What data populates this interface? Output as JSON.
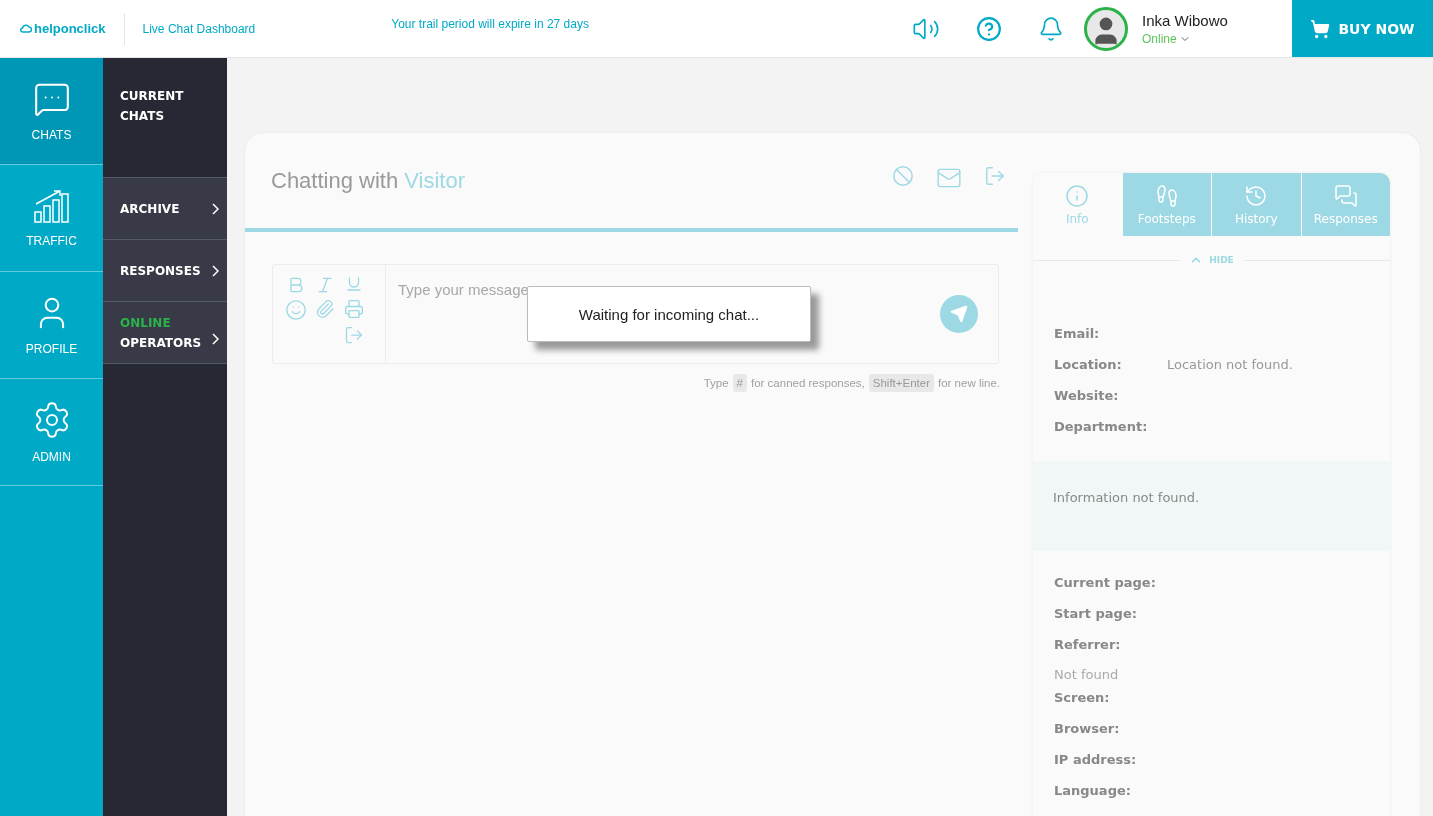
{
  "header": {
    "logo": "helponclick",
    "subtitle": "Live Chat Dashboard",
    "notice": "Your trail period will expire in 27 days",
    "user": {
      "name": "Inka Wibowo",
      "status": "Online"
    },
    "buy": "BUY NOW"
  },
  "nav": [
    {
      "kind": "chats",
      "label": "CHATS",
      "selected": true
    },
    {
      "kind": "traffic",
      "label": "TRAFFIC",
      "selected": false
    },
    {
      "kind": "profile",
      "label": "PROFILE",
      "selected": false
    },
    {
      "kind": "admin",
      "label": "ADMIN",
      "selected": false
    }
  ],
  "subnav": [
    {
      "label": "CURRENT CHATS",
      "selected": true,
      "arrow": false
    },
    {
      "label": "ARCHIVE",
      "selected": false,
      "arrow": true
    },
    {
      "label": "RESPONSES",
      "selected": false,
      "arrow": true
    },
    {
      "prefix": "ONLINE",
      "label": "OPERATORS",
      "selected": false,
      "arrow": true
    }
  ],
  "chat": {
    "title": "Chatting with",
    "visitor": "Visitor",
    "placeholder": "Type your message",
    "popup": "Waiting for incoming chat...",
    "hint": [
      {
        "kind": "text",
        "text": "Type"
      },
      {
        "kind": "key",
        "text": "#"
      },
      {
        "kind": "text",
        "text": "for canned responses,"
      },
      {
        "kind": "key",
        "text": "Shift+Enter"
      },
      {
        "kind": "text",
        "text": "for new line."
      }
    ]
  },
  "panel": {
    "tabs": [
      {
        "kind": "info",
        "label": "Info",
        "selected": true
      },
      {
        "kind": "footsteps",
        "label": "Footsteps",
        "selected": false
      },
      {
        "kind": "history",
        "label": "History",
        "selected": false
      },
      {
        "kind": "responses",
        "label": "Responses",
        "selected": false
      }
    ],
    "hide": "HIDE",
    "fields": [
      {
        "kind": "field",
        "label": "Email:"
      },
      {
        "kind": "field",
        "label": "Location:",
        "value": "Location not found."
      },
      {
        "kind": "field",
        "label": "Website:"
      },
      {
        "kind": "field",
        "label": "Department:"
      }
    ],
    "note": "Information not found.",
    "page_fields": [
      {
        "kind": "field",
        "label": "Current page:"
      },
      {
        "kind": "field",
        "label": "Start page:"
      },
      {
        "kind": "field",
        "label": "Referrer:"
      },
      {
        "kind": "note",
        "label": "Not found"
      },
      {
        "kind": "field",
        "label": "Screen:"
      },
      {
        "kind": "field",
        "label": "Browser:"
      },
      {
        "kind": "field",
        "label": "IP address:"
      },
      {
        "kind": "field",
        "label": "Language:"
      }
    ]
  }
}
